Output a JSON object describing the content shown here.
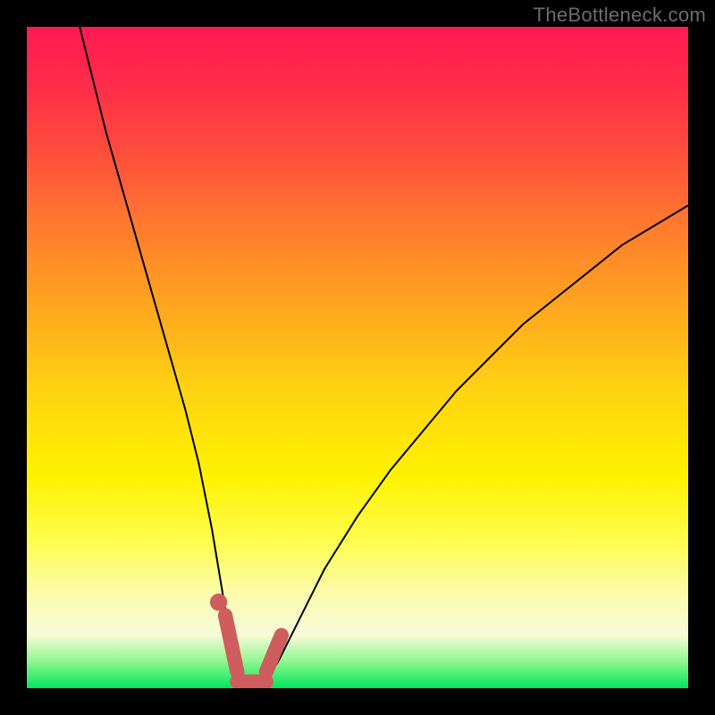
{
  "watermark": "TheBottleneck.com",
  "chart_data": {
    "type": "line",
    "title": "",
    "xlabel": "",
    "ylabel": "",
    "xlim": [
      0,
      100
    ],
    "ylim": [
      0,
      100
    ],
    "series": [
      {
        "name": "bottleneck-curve",
        "x": [
          8,
          10,
          12,
          14,
          16,
          18,
          20,
          22,
          24,
          26,
          28,
          29,
          30,
          31,
          32,
          33,
          34,
          35,
          36,
          38,
          40,
          42,
          45,
          50,
          55,
          60,
          65,
          70,
          75,
          80,
          85,
          90,
          95,
          100
        ],
        "values": [
          100,
          92,
          84,
          77,
          70,
          63,
          56,
          49,
          42,
          34,
          24,
          18,
          12,
          6,
          2,
          0,
          0,
          0,
          1,
          4,
          8,
          12,
          18,
          26,
          33,
          39,
          45,
          50,
          55,
          59,
          63,
          67,
          70,
          73
        ]
      }
    ],
    "markers": [
      {
        "name": "highlight-point-left",
        "x": 29.0,
        "y": 13.0,
        "r": 1.0,
        "color": "#cf5d5d"
      },
      {
        "name": "highlight-stroke-left-down",
        "x1": 30.0,
        "y1": 11.0,
        "x2": 31.8,
        "y2": 2.5,
        "w": 2.2,
        "color": "#cf5d5d"
      },
      {
        "name": "highlight-stroke-bottom",
        "x1": 31.8,
        "y1": 1.0,
        "x2": 36.2,
        "y2": 1.0,
        "w": 2.2,
        "color": "#cf5d5d"
      },
      {
        "name": "highlight-stroke-right-up",
        "x1": 36.2,
        "y1": 2.5,
        "x2": 38.5,
        "y2": 8.0,
        "w": 2.2,
        "color": "#cf5d5d"
      }
    ]
  }
}
